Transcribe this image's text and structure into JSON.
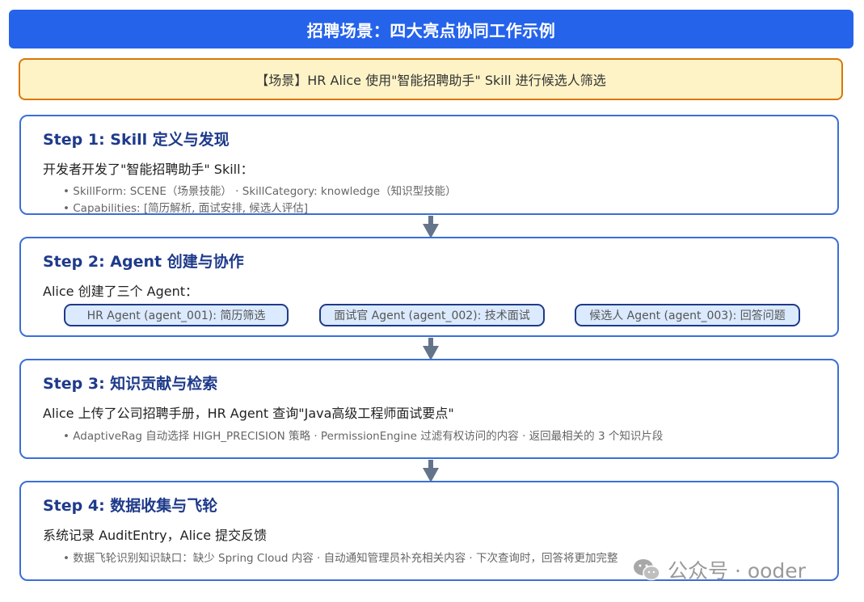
{
  "title": "招聘场景：四大亮点协同工作示例",
  "scenario": "【场景】HR Alice 使用\"智能招聘助手\" Skill 进行候选人筛选",
  "steps": [
    {
      "title": "Step 1: Skill 定义与发现",
      "desc": "开发者开发了\"智能招聘助手\" Skill：",
      "bullets": [
        "• SkillForm: SCENE（场景技能） · SkillCategory: knowledge（知识型技能）",
        "• Capabilities: [简历解析, 面试安排, 候选人评估]"
      ]
    },
    {
      "title": "Step 2: Agent 创建与协作",
      "desc": "Alice 创建了三个 Agent：",
      "agents": [
        "HR Agent (agent_001): 简历筛选",
        "面试官 Agent (agent_002): 技术面试",
        "候选人 Agent (agent_003): 回答问题"
      ]
    },
    {
      "title": "Step 3: 知识贡献与检索",
      "desc": "Alice 上传了公司招聘手册，HR Agent 查询\"Java高级工程师面试要点\"",
      "bullets": [
        "• AdaptiveRag 自动选择 HIGH_PRECISION 策略 · PermissionEngine 过滤有权访问的内容 · 返回最相关的 3 个知识片段"
      ]
    },
    {
      "title": "Step 4: 数据收集与飞轮",
      "desc": "系统记录 AuditEntry，Alice 提交反馈",
      "bullets": [
        "• 数据飞轮识别知识缺口：缺少 Spring Cloud 内容 · 自动通知管理员补充相关内容 · 下次查询时，回答将更加完整"
      ]
    }
  ],
  "watermark": "公众号 · ooder",
  "colors": {
    "title_bg": "#2563eb",
    "scenario_bg": "#fef3c7",
    "scenario_border": "#d97706",
    "step_border": "#3b6fd8",
    "step_title": "#1e3a8a",
    "pill_bg": "#dbeafe",
    "arrow": "#64748b"
  }
}
